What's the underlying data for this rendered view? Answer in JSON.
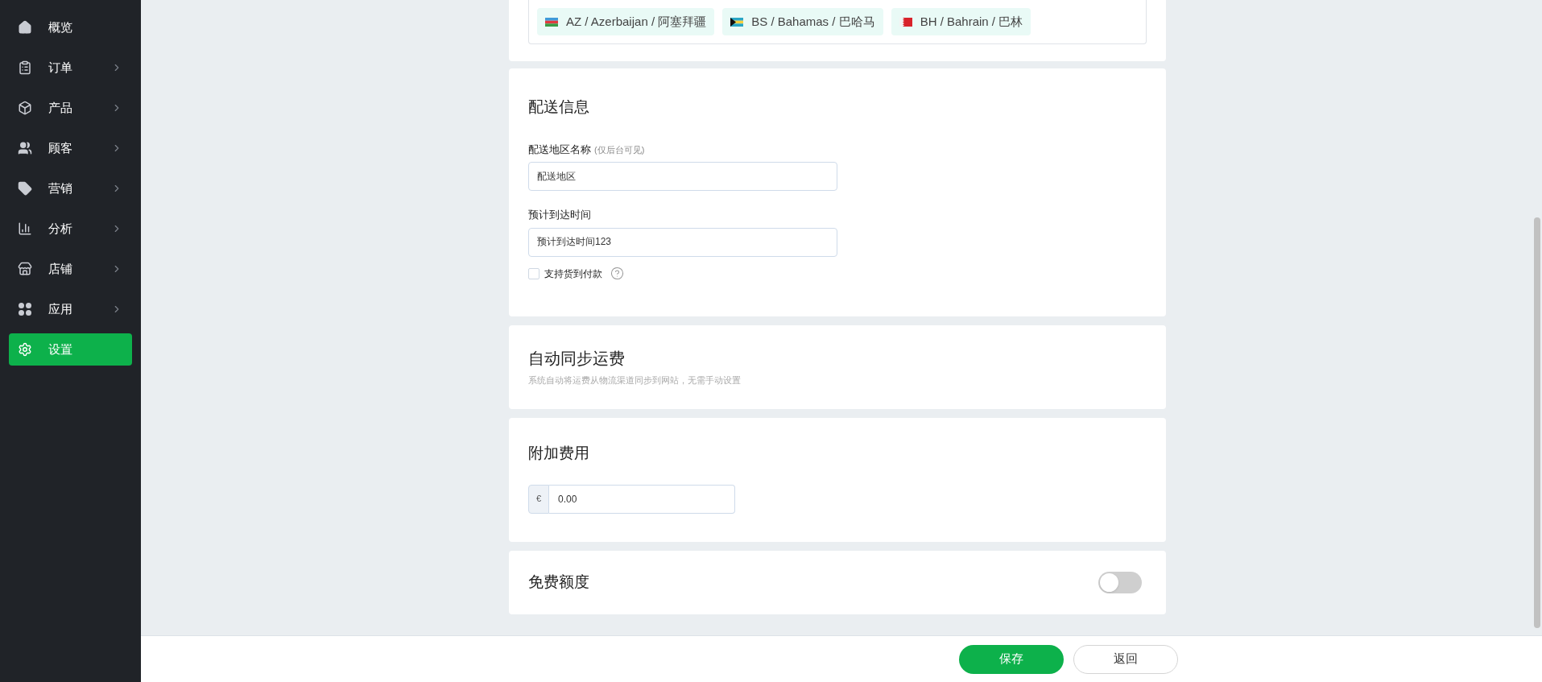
{
  "sidebar": {
    "items": [
      {
        "label": "概览",
        "kind": "home",
        "has_submenu": false,
        "selected": false
      },
      {
        "label": "订单",
        "kind": "clipboard",
        "has_submenu": true,
        "selected": false
      },
      {
        "label": "产品",
        "kind": "box",
        "has_submenu": true,
        "selected": false
      },
      {
        "label": "顾客",
        "kind": "users",
        "has_submenu": true,
        "selected": false
      },
      {
        "label": "营销",
        "kind": "tag",
        "has_submenu": true,
        "selected": false
      },
      {
        "label": "分析",
        "kind": "chart",
        "has_submenu": true,
        "selected": false
      },
      {
        "label": "店铺",
        "kind": "store",
        "has_submenu": true,
        "selected": false
      },
      {
        "label": "应用",
        "kind": "apps",
        "has_submenu": true,
        "selected": false
      },
      {
        "label": "设置",
        "kind": "gear",
        "has_submenu": false,
        "selected": true
      }
    ]
  },
  "regions": [
    {
      "label": "AZ / Azerbaijan / 阿塞拜疆",
      "kind": "az"
    },
    {
      "label": "BS / Bahamas / 巴哈马",
      "kind": "bs"
    },
    {
      "label": "BH / Bahrain / 巴林",
      "kind": "bh"
    }
  ],
  "delivery": {
    "title": "配送信息",
    "name_label": "配送地区名称",
    "name_hint": "(仅后台可见)",
    "name_value": "配送地区",
    "time_label": "预计到达时间",
    "time_value": "预计到达时间123",
    "cod": {
      "label": "支持货到付款",
      "checked": false
    }
  },
  "auto_sync": {
    "title": "自动同步运费",
    "description": "系统自动将运费从物流渠道同步到网站，无需手动设置"
  },
  "extra_fee": {
    "title": "附加费用",
    "currency": "€",
    "value": "0.00"
  },
  "free_quota": {
    "title": "免费额度",
    "on": false
  },
  "buttons": {
    "save": "保存",
    "back": "返回"
  }
}
